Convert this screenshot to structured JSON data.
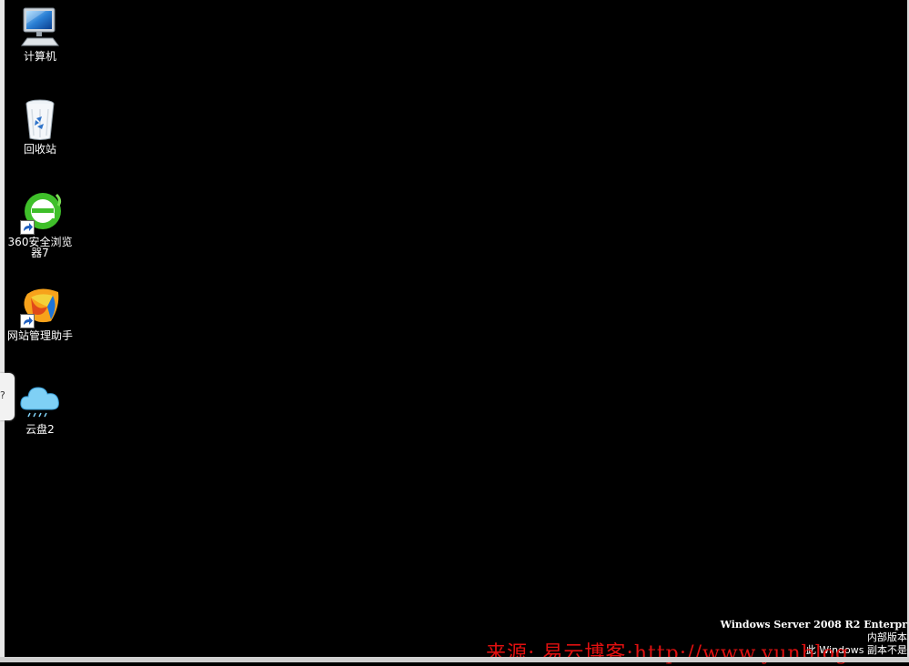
{
  "desktop": {
    "icons": [
      {
        "label": "计算机",
        "icon": "computer-icon"
      },
      {
        "label": "回收站",
        "icon": "recycle-bin-icon"
      },
      {
        "label": "360安全浏览器7",
        "icon": "browser-360-icon",
        "shortcut": true
      },
      {
        "label": "网站管理助手",
        "icon": "website-manager-icon",
        "shortcut": true
      },
      {
        "label": "云盘2",
        "icon": "cloud-drive-icon"
      }
    ]
  },
  "os_watermark": {
    "line1": "Windows Server 2008 R2 Enterpr",
    "line2": "内部版本",
    "line3": "此 Windows 副本不是"
  },
  "source_credit": "来源: 易云博客:http://www.yunblog.",
  "side_tab_glyph": "?",
  "colors": {
    "desktop_bg": "#000000",
    "credit": "#e01010"
  }
}
